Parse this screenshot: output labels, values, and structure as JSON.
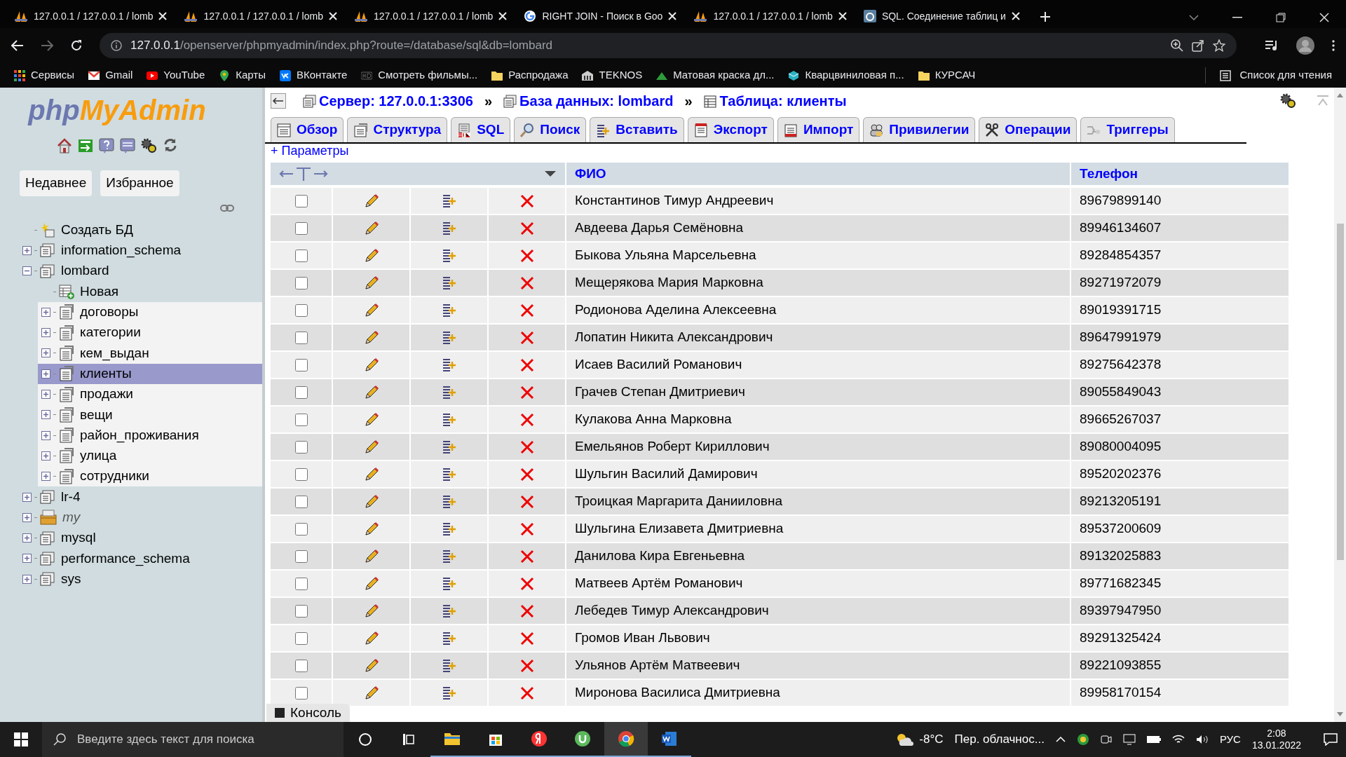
{
  "browser": {
    "tabs": [
      {
        "title": "127.0.0.1 / 127.0.0.1 / lomb",
        "kind": "pma",
        "selected": false
      },
      {
        "title": "127.0.0.1 / 127.0.0.1 / lomb",
        "kind": "pma",
        "selected": false
      },
      {
        "title": "127.0.0.1 / 127.0.0.1 / lomb",
        "kind": "pma",
        "selected": false
      },
      {
        "title": "RIGHT JOIN - Поиск в Goo",
        "kind": "google",
        "selected": false
      },
      {
        "title": "127.0.0.1 / 127.0.0.1 / lomb",
        "kind": "pma",
        "selected": false
      },
      {
        "title": "SQL. Соединение таблиц и",
        "kind": "site",
        "selected": false
      }
    ],
    "address": {
      "host": "127.0.0.1",
      "path": "/openserver/phpmyadmin/index.php?route=/database/sql&db=lombard"
    },
    "bookmarks": [
      {
        "label": "Сервисы",
        "kind": "apps"
      },
      {
        "label": "Gmail",
        "kind": "gmail"
      },
      {
        "label": "YouTube",
        "kind": "youtube"
      },
      {
        "label": "Карты",
        "kind": "maps"
      },
      {
        "label": "ВКонтакте",
        "kind": "vk"
      },
      {
        "label": "Смотреть фильмы...",
        "kind": "hd"
      },
      {
        "label": "Распродажа",
        "kind": "folder"
      },
      {
        "label": "TEKNOS",
        "kind": "building"
      },
      {
        "label": "Матовая краска дл...",
        "kind": "triangle"
      },
      {
        "label": "Кварцвиниловая п...",
        "kind": "cube"
      },
      {
        "label": "КУРСАЧ",
        "kind": "folder"
      }
    ],
    "reading_list": "Список для чтения"
  },
  "sidebar": {
    "logo": {
      "part_1": "php",
      "part_2": "MyAdmin"
    },
    "buttons": [
      "Недавнее",
      "Избранное"
    ],
    "tree": [
      {
        "label": "Создать БД",
        "kind": "new_db"
      },
      {
        "label": "information_schema",
        "kind": "db",
        "expanded": false
      },
      {
        "label": "lombard",
        "kind": "db",
        "expanded": true,
        "children": [
          {
            "label": "Новая",
            "kind": "new_table"
          },
          {
            "label": "договоры",
            "kind": "table",
            "expanded": false,
            "selected": false
          },
          {
            "label": "категории",
            "kind": "table",
            "expanded": false,
            "selected": false
          },
          {
            "label": "кем_выдан",
            "kind": "table",
            "expanded": false,
            "selected": false
          },
          {
            "label": "клиенты",
            "kind": "table",
            "expanded": false,
            "selected": true
          },
          {
            "label": "продажи",
            "kind": "table",
            "expanded": false,
            "selected": false
          },
          {
            "label": "вещи",
            "kind": "table",
            "expanded": false,
            "selected": false
          },
          {
            "label": "район_проживания",
            "kind": "table",
            "expanded": false,
            "selected": false
          },
          {
            "label": "улица",
            "kind": "table",
            "expanded": false,
            "selected": false
          },
          {
            "label": "сотрудники",
            "kind": "table",
            "expanded": false,
            "selected": false
          }
        ]
      },
      {
        "label": "lr-4",
        "kind": "db",
        "expanded": false
      },
      {
        "label": "my",
        "kind": "special_db",
        "expanded": false
      },
      {
        "label": "mysql",
        "kind": "db",
        "expanded": false
      },
      {
        "label": "performance_schema",
        "kind": "db",
        "expanded": false
      },
      {
        "label": "sys",
        "kind": "db",
        "expanded": false
      }
    ]
  },
  "main": {
    "breadcrumbs": [
      {
        "label": "Сервер: 127.0.0.1:3306",
        "kind": "server"
      },
      {
        "label": "База данных: lombard",
        "kind": "db"
      },
      {
        "label": "Таблица: клиенты",
        "kind": "table"
      }
    ],
    "separator": "»",
    "tabs": [
      {
        "label": "Обзор",
        "selected": false
      },
      {
        "label": "Структура",
        "selected": false
      },
      {
        "label": "SQL",
        "selected": false
      },
      {
        "label": "Поиск",
        "selected": false
      },
      {
        "label": "Вставить",
        "selected": false
      },
      {
        "label": "Экспорт",
        "selected": false
      },
      {
        "label": "Импорт",
        "selected": false
      },
      {
        "label": "Привилегии",
        "selected": false
      },
      {
        "label": "Операции",
        "selected": false
      },
      {
        "label": "Триггеры",
        "selected": false
      }
    ],
    "options_link": "+ Параметры",
    "table": {
      "columns": [
        "ФИО",
        "Телефон"
      ],
      "rows": [
        {
          "checked": false,
          "fio": "Константинов Тимур Андреевич",
          "phone": "89679899140"
        },
        {
          "checked": false,
          "fio": "Авдеева Дарья Семёновна",
          "phone": "89946134607"
        },
        {
          "checked": false,
          "fio": "Быкова Ульяна Марсельевна",
          "phone": "89284854357"
        },
        {
          "checked": false,
          "fio": "Мещерякова Мария Марковна",
          "phone": "89271972079"
        },
        {
          "checked": false,
          "fio": "Родионова Аделина Алексеевна",
          "phone": "89019391715"
        },
        {
          "checked": false,
          "fio": "Лопатин Никита Александрович",
          "phone": "89647991979"
        },
        {
          "checked": false,
          "fio": "Исаев Василий Романович",
          "phone": "89275642378"
        },
        {
          "checked": false,
          "fio": "Грачев Степан Дмитриевич",
          "phone": "89055849043"
        },
        {
          "checked": false,
          "fio": "Кулакова Анна Марковна",
          "phone": "89665267037"
        },
        {
          "checked": false,
          "fio": "Емельянов Роберт Кириллович",
          "phone": "89080004095"
        },
        {
          "checked": false,
          "fio": "Шульгин Василий Дамирович",
          "phone": "89520202376"
        },
        {
          "checked": false,
          "fio": "Троицкая Маргарита Данииловна",
          "phone": "89213205191"
        },
        {
          "checked": false,
          "fio": "Шульгина Елизавета Дмитриевна",
          "phone": "89537200609"
        },
        {
          "checked": false,
          "fio": "Данилова Кира Евгеньевна",
          "phone": "89132025883"
        },
        {
          "checked": false,
          "fio": "Матвеев Артём Романович",
          "phone": "89771682345"
        },
        {
          "checked": false,
          "fio": "Лебедев Тимур Александрович",
          "phone": "89397947950"
        },
        {
          "checked": false,
          "fio": "Громов Иван Львович",
          "phone": "89291325424"
        },
        {
          "checked": false,
          "fio": "Ульянов Артём Матвеевич",
          "phone": "89221093855"
        },
        {
          "checked": false,
          "fio": "Миронова Василиса Дмитриевна",
          "phone": "89958170154"
        }
      ]
    },
    "console": "Консоль"
  },
  "taskbar": {
    "search_placeholder": "Введите здесь текст для поиска",
    "temperature": "-8°C",
    "weather": "Пер. облачнос...",
    "language": "РУС",
    "time": "2:08",
    "date": "13.01.2022"
  }
}
